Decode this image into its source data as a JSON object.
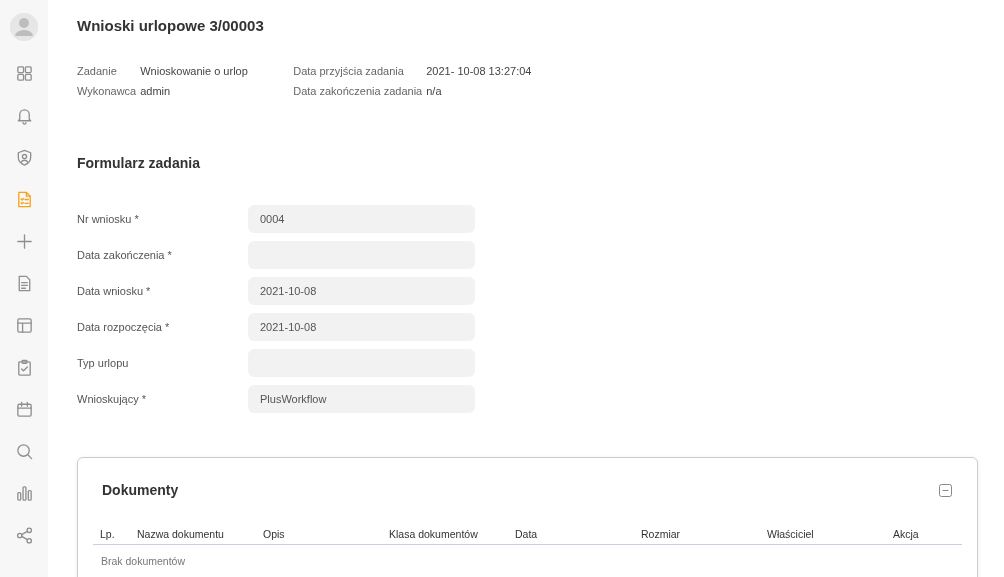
{
  "sidebar": {
    "items": [
      {
        "selected": false
      },
      {
        "selected": false
      },
      {
        "selected": false
      },
      {
        "selected": true
      },
      {
        "selected": false
      },
      {
        "selected": false
      },
      {
        "selected": false
      },
      {
        "selected": false
      },
      {
        "selected": false
      },
      {
        "selected": false
      },
      {
        "selected": false
      },
      {
        "selected": false
      }
    ]
  },
  "title": "Wnioski urlopowe 3/00003",
  "task_info": [
    {
      "label": "Zadanie",
      "value": "Wnioskowanie o urlop"
    },
    {
      "label": "Data przyjścia zadania",
      "value": "2021- 10-08 13:27:04"
    },
    {
      "label": "Wykonawca",
      "value": "admin"
    },
    {
      "label": "Data zakończenia zadania",
      "value": "n/a"
    }
  ],
  "form": {
    "title": "Formularz zadania",
    "fields": [
      {
        "label": "Nr wniosku *",
        "value": "0004"
      },
      {
        "label": "Data zakończenia *"
      },
      {
        "label": "Data wniosku *",
        "value": "2021-10-08"
      },
      {
        "label": "Data rozpoczęcia *",
        "value": "2021-10-08"
      },
      {
        "label": "Typ urlopu"
      },
      {
        "label": "Wnioskujący *",
        "value": "PlusWorkflow"
      }
    ]
  },
  "documents": {
    "title": "Dokumenty",
    "expanded": true,
    "columns": [
      "Lp.",
      "Nazwa dokumentu",
      "Opis",
      "Klasa dokumentów",
      "Data",
      "Rozmiar",
      "Właściciel",
      "Akcja"
    ],
    "empty_text": "Brak dokumentów"
  }
}
